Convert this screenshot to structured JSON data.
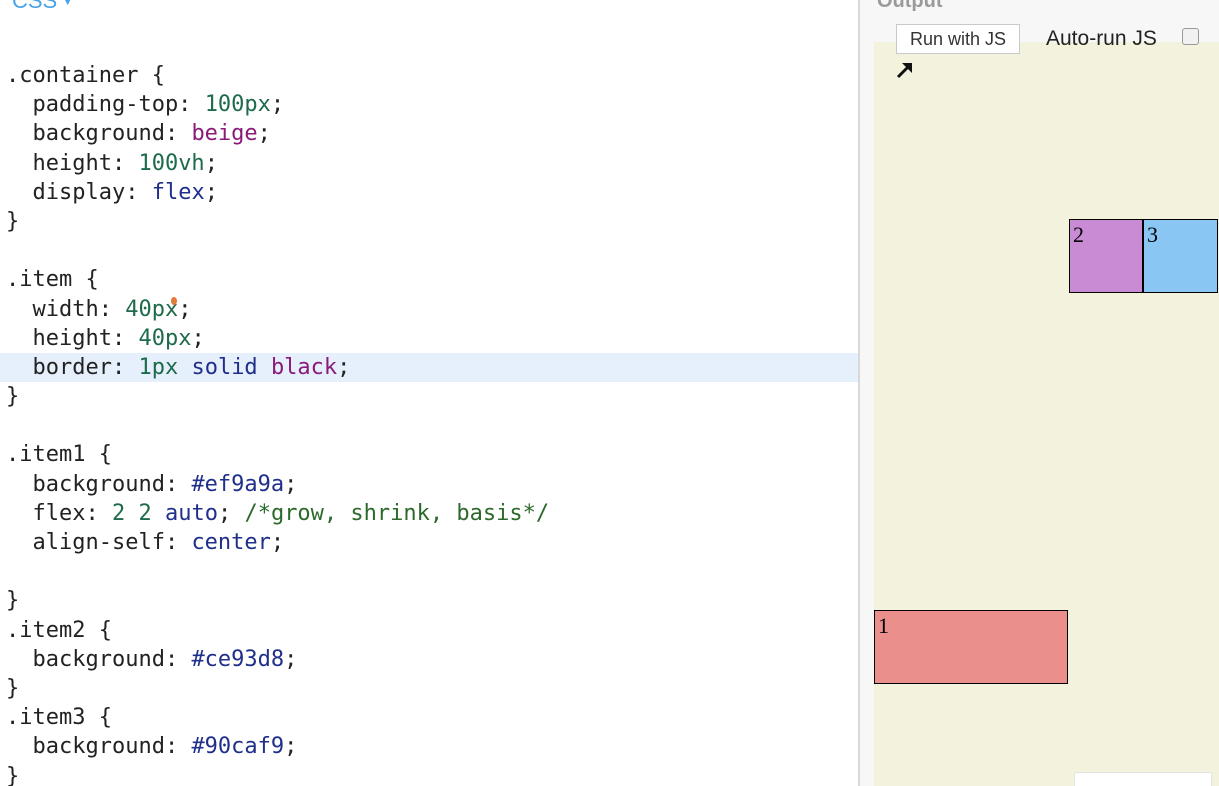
{
  "editor": {
    "language_label": "CSS",
    "lines": [
      [
        {
          "t": ".container {",
          "c": "t-sel"
        }
      ],
      [
        {
          "t": "  padding-top: ",
          "c": "t-prop"
        },
        {
          "t": "100px",
          "c": "t-num"
        },
        {
          "t": ";",
          "c": "t-punc"
        }
      ],
      [
        {
          "t": "  background: ",
          "c": "t-prop"
        },
        {
          "t": "beige",
          "c": "t-kw"
        },
        {
          "t": ";",
          "c": "t-punc"
        }
      ],
      [
        {
          "t": "  height: ",
          "c": "t-prop"
        },
        {
          "t": "100vh",
          "c": "t-num"
        },
        {
          "t": ";",
          "c": "t-punc"
        }
      ],
      [
        {
          "t": "  display: ",
          "c": "t-prop"
        },
        {
          "t": "flex",
          "c": "t-atom"
        },
        {
          "t": ";",
          "c": "t-punc"
        }
      ],
      [
        {
          "t": "}",
          "c": "t-punc"
        }
      ],
      [
        {
          "t": "",
          "c": "t-punc"
        }
      ],
      [
        {
          "t": ".item {",
          "c": "t-sel"
        }
      ],
      [
        {
          "t": "  width: ",
          "c": "t-prop"
        },
        {
          "t": "40px",
          "c": "t-num"
        },
        {
          "t": ";",
          "c": "t-punc"
        }
      ],
      [
        {
          "t": "  height: ",
          "c": "t-prop"
        },
        {
          "t": "40px",
          "c": "t-num"
        },
        {
          "t": ";",
          "c": "t-punc"
        }
      ],
      [
        {
          "t": "  border: ",
          "c": "t-prop"
        },
        {
          "t": "1px",
          "c": "t-num"
        },
        {
          "t": " ",
          "c": "t-punc"
        },
        {
          "t": "solid",
          "c": "t-atom"
        },
        {
          "t": " ",
          "c": "t-punc"
        },
        {
          "t": "black",
          "c": "t-kw"
        },
        {
          "t": ";",
          "c": "t-punc"
        }
      ],
      [
        {
          "t": "}",
          "c": "t-punc"
        }
      ],
      [
        {
          "t": "",
          "c": "t-punc"
        }
      ],
      [
        {
          "t": ".item1 {",
          "c": "t-sel"
        }
      ],
      [
        {
          "t": "  background: ",
          "c": "t-prop"
        },
        {
          "t": "#ef9a9a",
          "c": "t-hex"
        },
        {
          "t": ";",
          "c": "t-punc"
        }
      ],
      [
        {
          "t": "  flex: ",
          "c": "t-prop"
        },
        {
          "t": "2 2",
          "c": "t-num"
        },
        {
          "t": " ",
          "c": "t-punc"
        },
        {
          "t": "auto",
          "c": "t-atom"
        },
        {
          "t": "; ",
          "c": "t-punc"
        },
        {
          "t": "/*grow, shrink, basis*/",
          "c": "t-comment"
        }
      ],
      [
        {
          "t": "  align-self: ",
          "c": "t-prop"
        },
        {
          "t": "center",
          "c": "t-atom"
        },
        {
          "t": ";",
          "c": "t-punc"
        }
      ],
      [
        {
          "t": "",
          "c": "t-punc"
        }
      ],
      [
        {
          "t": "}",
          "c": "t-punc"
        }
      ],
      [
        {
          "t": ".item2 {",
          "c": "t-sel"
        }
      ],
      [
        {
          "t": "  background: ",
          "c": "t-prop"
        },
        {
          "t": "#ce93d8",
          "c": "t-hex"
        },
        {
          "t": ";",
          "c": "t-punc"
        }
      ],
      [
        {
          "t": "}",
          "c": "t-punc"
        }
      ],
      [
        {
          "t": ".item3 {",
          "c": "t-sel"
        }
      ],
      [
        {
          "t": "  background: ",
          "c": "t-prop"
        },
        {
          "t": "#90caf9",
          "c": "t-hex"
        },
        {
          "t": ";",
          "c": "t-punc"
        }
      ],
      [
        {
          "t": "}",
          "c": "t-punc"
        }
      ]
    ],
    "active_line_index": 10
  },
  "output": {
    "title": "Output",
    "run_button_label": "Run with JS",
    "autorun_label": "Auto-run JS",
    "autorun_checked": false,
    "preview_background": "#f3f2dc",
    "items": [
      {
        "label": "1",
        "color": "#ea8f8c"
      },
      {
        "label": "2",
        "color": "#c98cd4"
      },
      {
        "label": "3",
        "color": "#8ac6f4"
      }
    ]
  },
  "colors": {
    "accent": "#4aa3e8",
    "active_line": "#e6effc"
  }
}
